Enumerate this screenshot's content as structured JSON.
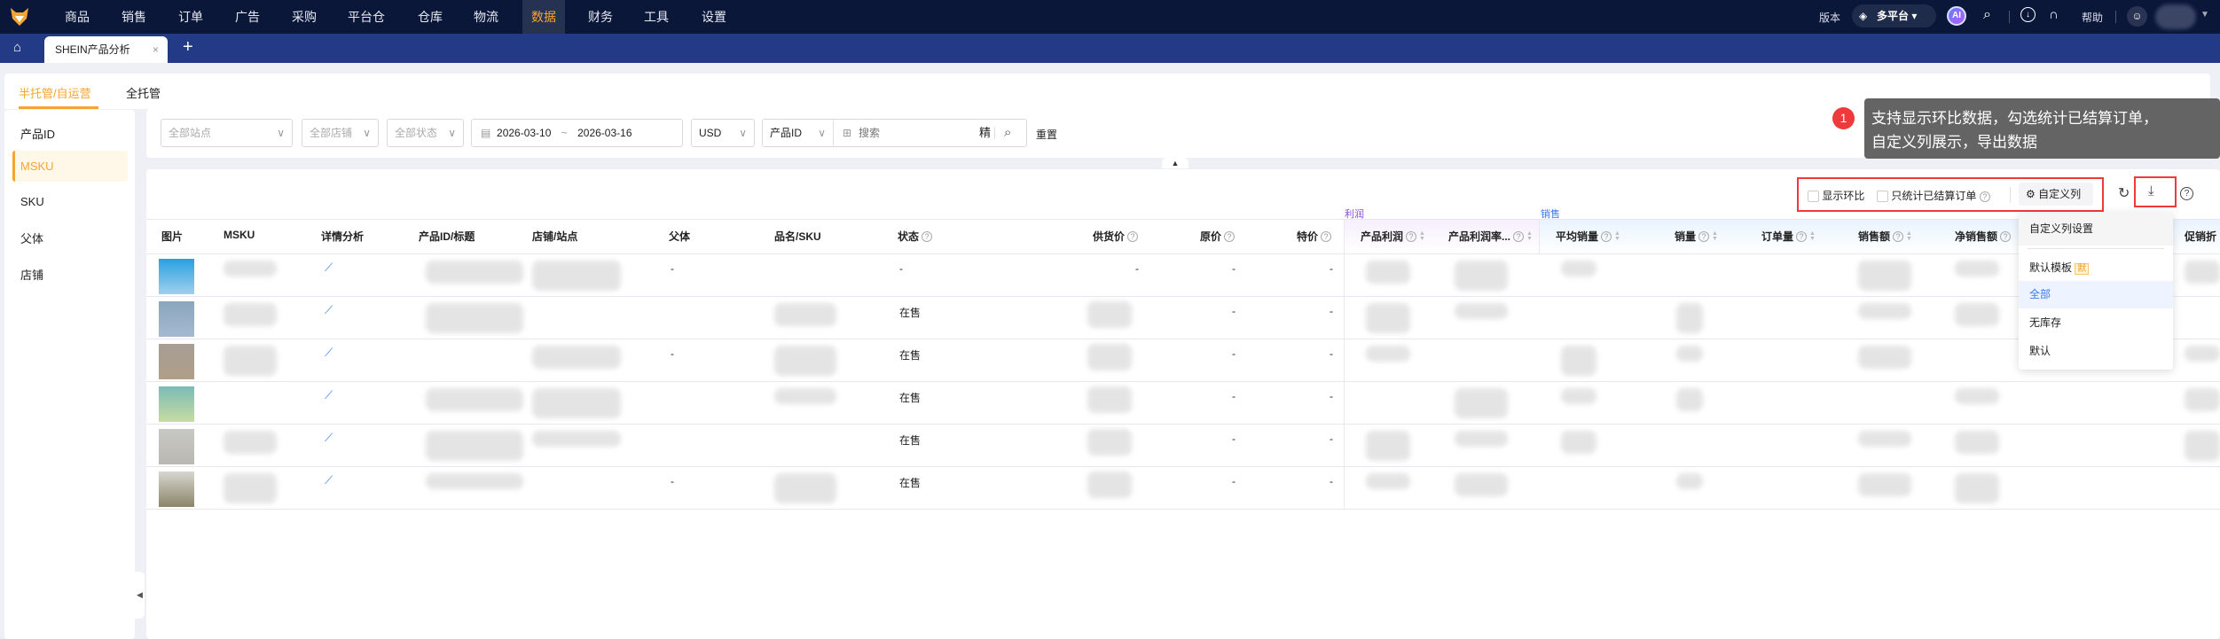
{
  "nav": {
    "items": [
      "商品",
      "销售",
      "订单",
      "广告",
      "采购",
      "平台仓",
      "仓库",
      "物流",
      "数据",
      "财务",
      "工具",
      "设置"
    ],
    "active": "数据",
    "version_label": "版本",
    "platform_label": "多平台",
    "ai_label": "AI",
    "help_label": "帮助"
  },
  "tabs": {
    "active_tab": "SHEIN产品分析",
    "close": "×",
    "add": "+"
  },
  "subtabs": [
    "半托管/自运营",
    "全托管"
  ],
  "sidebar": {
    "items": [
      "产品ID",
      "MSKU",
      "SKU",
      "父体",
      "店铺"
    ],
    "active": "MSKU"
  },
  "filters": {
    "site": "全部站点",
    "store": "全部店铺",
    "status": "全部状态",
    "date_start": "2026-03-10",
    "date_sep": "~",
    "date_end": "2026-03-16",
    "currency": "USD",
    "search_type": "产品ID",
    "search_placeholder": "搜索",
    "exact_label": "精",
    "reset_label": "重置"
  },
  "tooltip": {
    "badge": "1",
    "line1": "支持显示环比数据，勾选统计已结算订单，",
    "line2": "自定义列展示，导出数据"
  },
  "toolbar": {
    "show_mom": "显示环比",
    "settled_only": "只统计已结算订单",
    "custom_columns": "自定义列"
  },
  "dropdown": {
    "title": "自定义列设置",
    "items": [
      "默认模板",
      "全部",
      "无库存",
      "默认"
    ],
    "default_badge": "默",
    "selected": "全部"
  },
  "table": {
    "group_headers": {
      "profit": "利润",
      "sales": "销售"
    },
    "headers": [
      "图片",
      "MSKU",
      "详情分析",
      "产品ID/标题",
      "店铺/站点",
      "父体",
      "品名/SKU",
      "状态",
      "供货价",
      "原价",
      "特价",
      "产品利润",
      "产品利润率...",
      "平均销量",
      "销量",
      "订单量",
      "销售额",
      "净销售额",
      "促销折"
    ],
    "rows": [
      {
        "parent": "-",
        "status": "-",
        "supply": "-",
        "original": "-",
        "special": "-"
      },
      {
        "parent": "",
        "status": "在售",
        "supply": "",
        "original": "-",
        "special": "-"
      },
      {
        "parent": "-",
        "status": "在售",
        "supply": "",
        "original": "-",
        "special": "-"
      },
      {
        "parent": "",
        "status": "在售",
        "supply": "",
        "original": "-",
        "special": "-"
      },
      {
        "parent": "",
        "status": "在售",
        "supply": "",
        "original": "-",
        "special": "-"
      },
      {
        "parent": "-",
        "status": "在售",
        "supply": "",
        "original": "-",
        "special": "-"
      }
    ]
  },
  "colors": {
    "nav_bg": "#0b1738",
    "tab_bar": "#233a86",
    "accent": "#f7a531",
    "link": "#3a78f2",
    "highlight_red": "#f0393b"
  }
}
